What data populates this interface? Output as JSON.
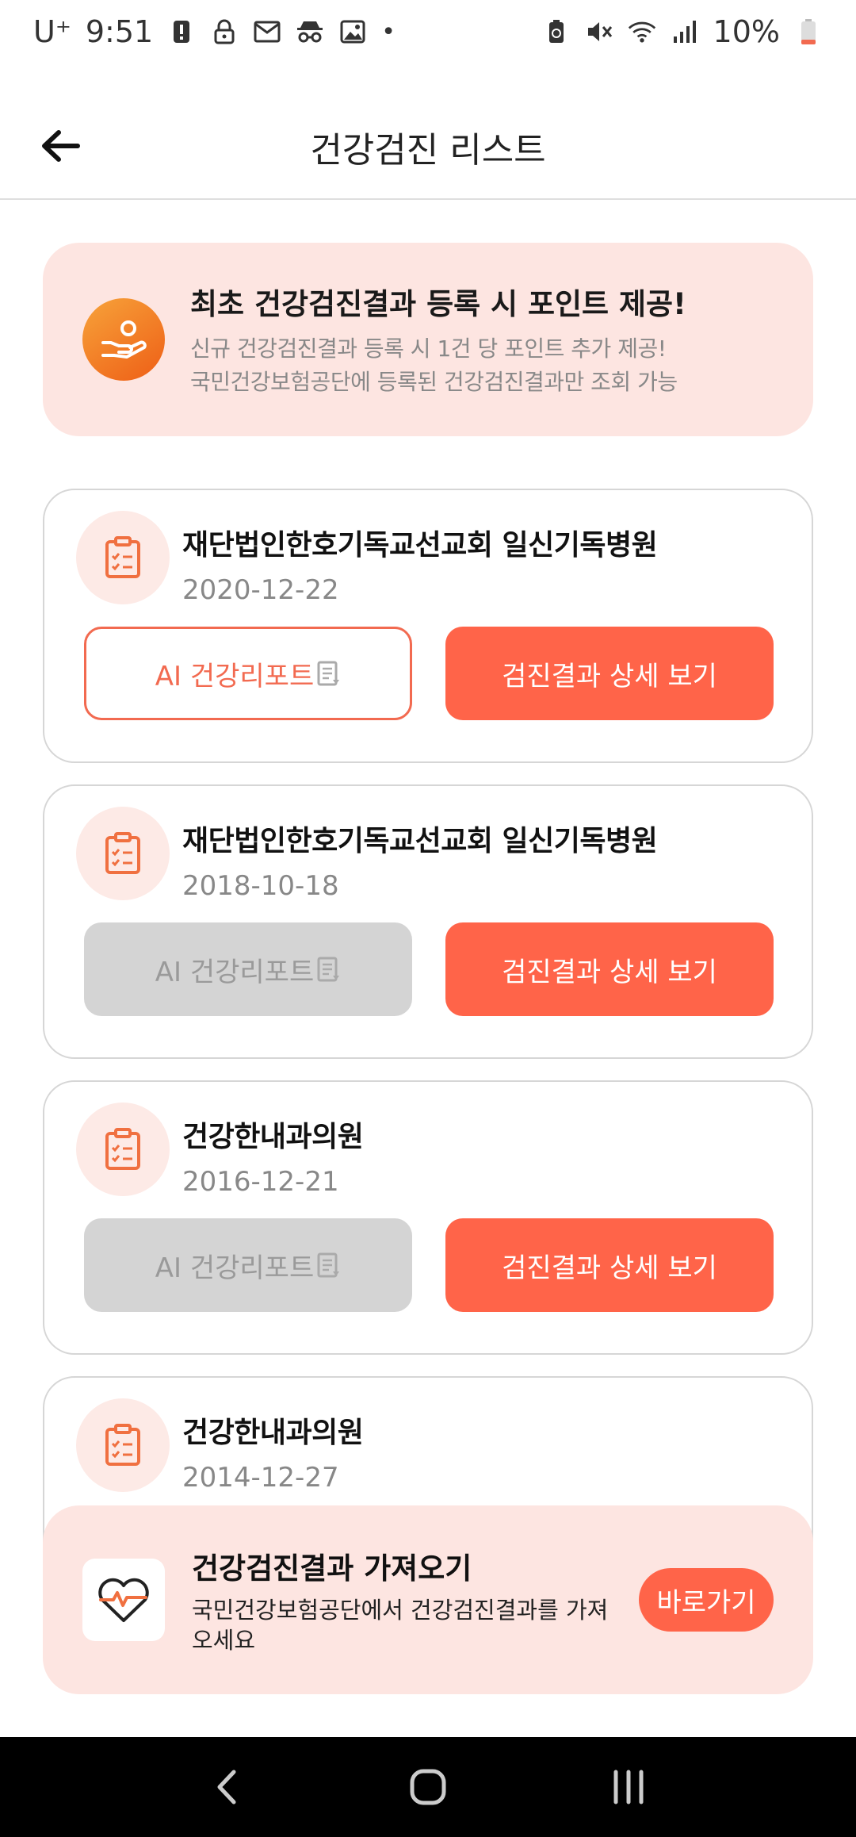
{
  "status_bar": {
    "carrier": "U⁺",
    "time": "9:51",
    "battery": "10%",
    "left_icons": [
      "alert-icon",
      "lock-icon",
      "mail-icon",
      "incognito-icon",
      "image-icon",
      "dot-icon"
    ],
    "right_icons": [
      "battery-saver-icon",
      "mute-icon",
      "wifi-icon",
      "signal-icon",
      "battery-icon"
    ]
  },
  "header": {
    "title": "건강검진 리스트",
    "back_icon": "arrow-left-icon"
  },
  "promo": {
    "icon": "hand-coin-icon",
    "title": "최초 건강검진결과 등록 시 포인트 제공!",
    "line1": "신규 건강검진결과 등록 시 1건 당 포인트 추가 제공!",
    "line2": "국민건강보험공단에 등록된 건강검진결과만 조회 가능"
  },
  "records": [
    {
      "hospital": "재단법인한호기독교선교회 일신기독병원",
      "date": "2020-12-22",
      "ai_label": "AI 건강리포트",
      "ai_enabled": true,
      "detail_label": "검진결과 상세 보기"
    },
    {
      "hospital": "재단법인한호기독교선교회 일신기독병원",
      "date": "2018-10-18",
      "ai_label": "AI 건강리포트",
      "ai_enabled": false,
      "detail_label": "검진결과 상세 보기"
    },
    {
      "hospital": "건강한내과의원",
      "date": "2016-12-21",
      "ai_label": "AI 건강리포트",
      "ai_enabled": false,
      "detail_label": "검진결과 상세 보기"
    },
    {
      "hospital": "건강한내과의원",
      "date": "2014-12-27"
    }
  ],
  "import_banner": {
    "icon": "heart-pulse-icon",
    "title": "건강검진결과 가져오기",
    "desc": "국민건강보험공단에서 건강검진결과를 가져오세요",
    "button": "바로가기"
  },
  "colors": {
    "accent": "#ff6449",
    "banner_bg": "#fde5e1",
    "disabled_bg": "#d4d4d4"
  }
}
